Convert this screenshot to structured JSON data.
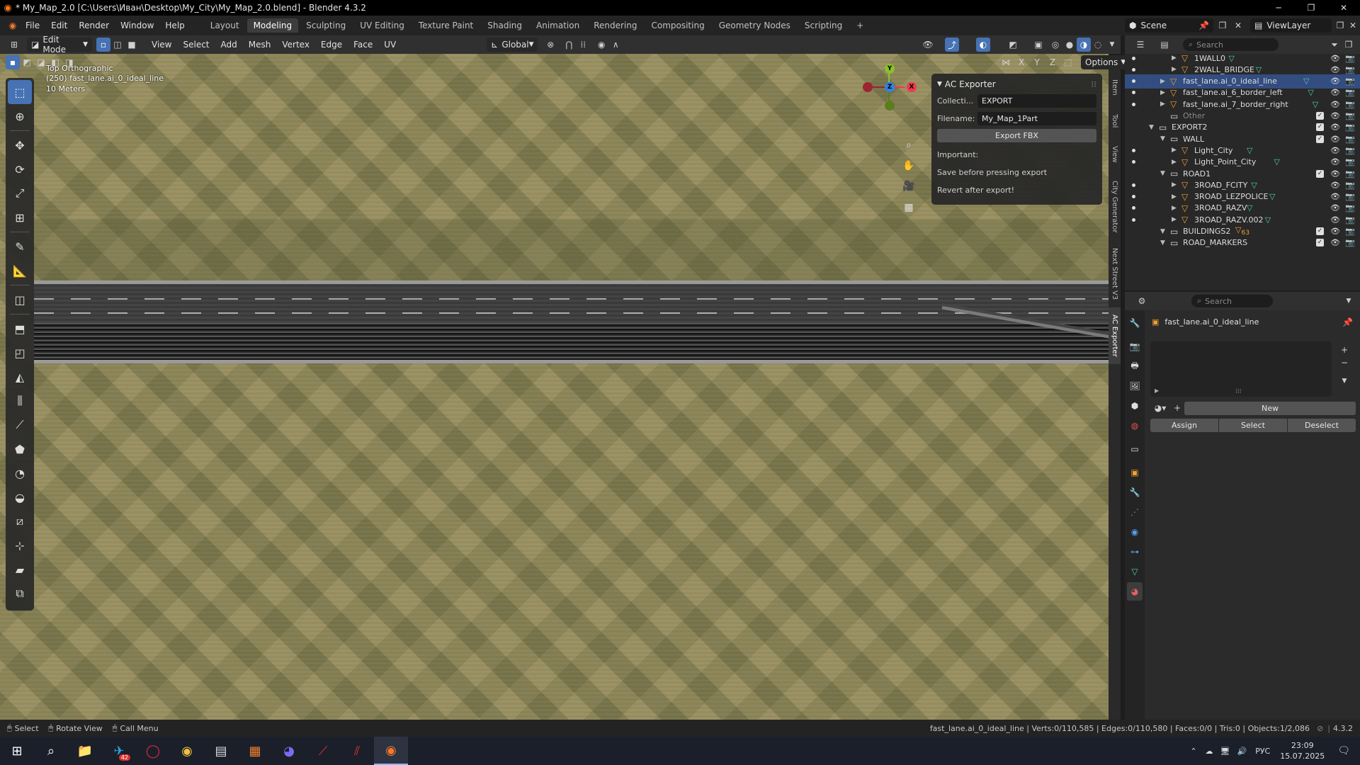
{
  "titlebar": {
    "title": "* My_Map_2.0 [C:\\Users\\Иван\\Desktop\\My_City\\My_Map_2.0.blend] - Blender 4.3.2",
    "minimize": "─",
    "restore": "❐",
    "close": "✕"
  },
  "menu": [
    "File",
    "Edit",
    "Render",
    "Window",
    "Help"
  ],
  "workspaces": [
    "Layout",
    "Modeling",
    "Sculpting",
    "UV Editing",
    "Texture Paint",
    "Shading",
    "Animation",
    "Rendering",
    "Compositing",
    "Geometry Nodes",
    "Scripting"
  ],
  "workspace_add": "+",
  "scene": {
    "label": "Scene",
    "view_layer": "ViewLayer"
  },
  "viewport_header": {
    "mode": "Edit Mode",
    "menus": [
      "View",
      "Select",
      "Add",
      "Mesh",
      "Vertex",
      "Edge",
      "Face",
      "UV"
    ],
    "transform_orientation": "Global",
    "options": "Options",
    "axes": [
      "X",
      "Y",
      "Z"
    ]
  },
  "viewport": {
    "view_name": "Top Orthographic",
    "object_info": "(250) fast_lane.ai_0_ideal_line",
    "scale": "10 Meters"
  },
  "gizmo": {
    "y": "Y",
    "z": "Z",
    "x": "X"
  },
  "ac_exporter": {
    "title": "AC Exporter",
    "collection_label": "Collecti...",
    "collection_value": "EXPORT",
    "filename_label": "Filename:",
    "filename_value": "My_Map_1Part",
    "export_button": "Export FBX",
    "important": "Important:",
    "note1": "Save before pressing export",
    "note2": "Revert after export!"
  },
  "side_tabs": [
    "Item",
    "Tool",
    "View",
    "City Generator",
    "Next Street V3",
    "AC Exporter"
  ],
  "outliner": {
    "search_placeholder": "Search",
    "rows": [
      {
        "name": "1WALL0",
        "indent": 2,
        "type": "mesh"
      },
      {
        "name": "2WALL_BRIDGE",
        "indent": 2,
        "type": "mesh"
      },
      {
        "name": "fast_lane.ai_0_ideal_line",
        "indent": 1,
        "type": "mesh",
        "selected": true
      },
      {
        "name": "fast_lane.ai_6_border_left",
        "indent": 1,
        "type": "mesh"
      },
      {
        "name": "fast_lane.ai_7_border_right",
        "indent": 1,
        "type": "mesh"
      },
      {
        "name": "Other",
        "indent": 1,
        "type": "collection-dim"
      },
      {
        "name": "EXPORT2",
        "indent": 0,
        "type": "collection"
      },
      {
        "name": "WALL",
        "indent": 1,
        "type": "collection"
      },
      {
        "name": "Light_City",
        "indent": 2,
        "type": "mesh"
      },
      {
        "name": "Light_Point_City",
        "indent": 2,
        "type": "mesh"
      },
      {
        "name": "ROAD1",
        "indent": 1,
        "type": "collection"
      },
      {
        "name": "3ROAD_FCITY",
        "indent": 2,
        "type": "mesh"
      },
      {
        "name": "3ROAD_LEZPOLICE",
        "indent": 2,
        "type": "mesh"
      },
      {
        "name": "3ROAD_RAZV",
        "indent": 2,
        "type": "mesh"
      },
      {
        "name": "3ROAD_RAZV.002",
        "indent": 2,
        "type": "mesh"
      },
      {
        "name": "BUILDINGS2",
        "indent": 1,
        "type": "collection",
        "badge": "63"
      },
      {
        "name": "ROAD_MARKERS",
        "indent": 1,
        "type": "collection"
      }
    ]
  },
  "properties": {
    "search_placeholder": "Search",
    "object_name": "fast_lane.ai_0_ideal_line",
    "new_button": "New",
    "assign": "Assign",
    "select": "Select",
    "deselect": "Deselect"
  },
  "statusbar": {
    "select": "Select",
    "rotate": "Rotate View",
    "call_menu": "Call Menu",
    "stats": "fast_lane.ai_0_ideal_line | Verts:0/110,585 | Edges:0/110,580 | Faces:0/0 | Tris:0 | Objects:1/2,086",
    "version": "4.3.2"
  },
  "taskbar": {
    "lang": "РУС",
    "time": "23:09",
    "date": "15.07.2025",
    "telegram_badge": "42"
  }
}
